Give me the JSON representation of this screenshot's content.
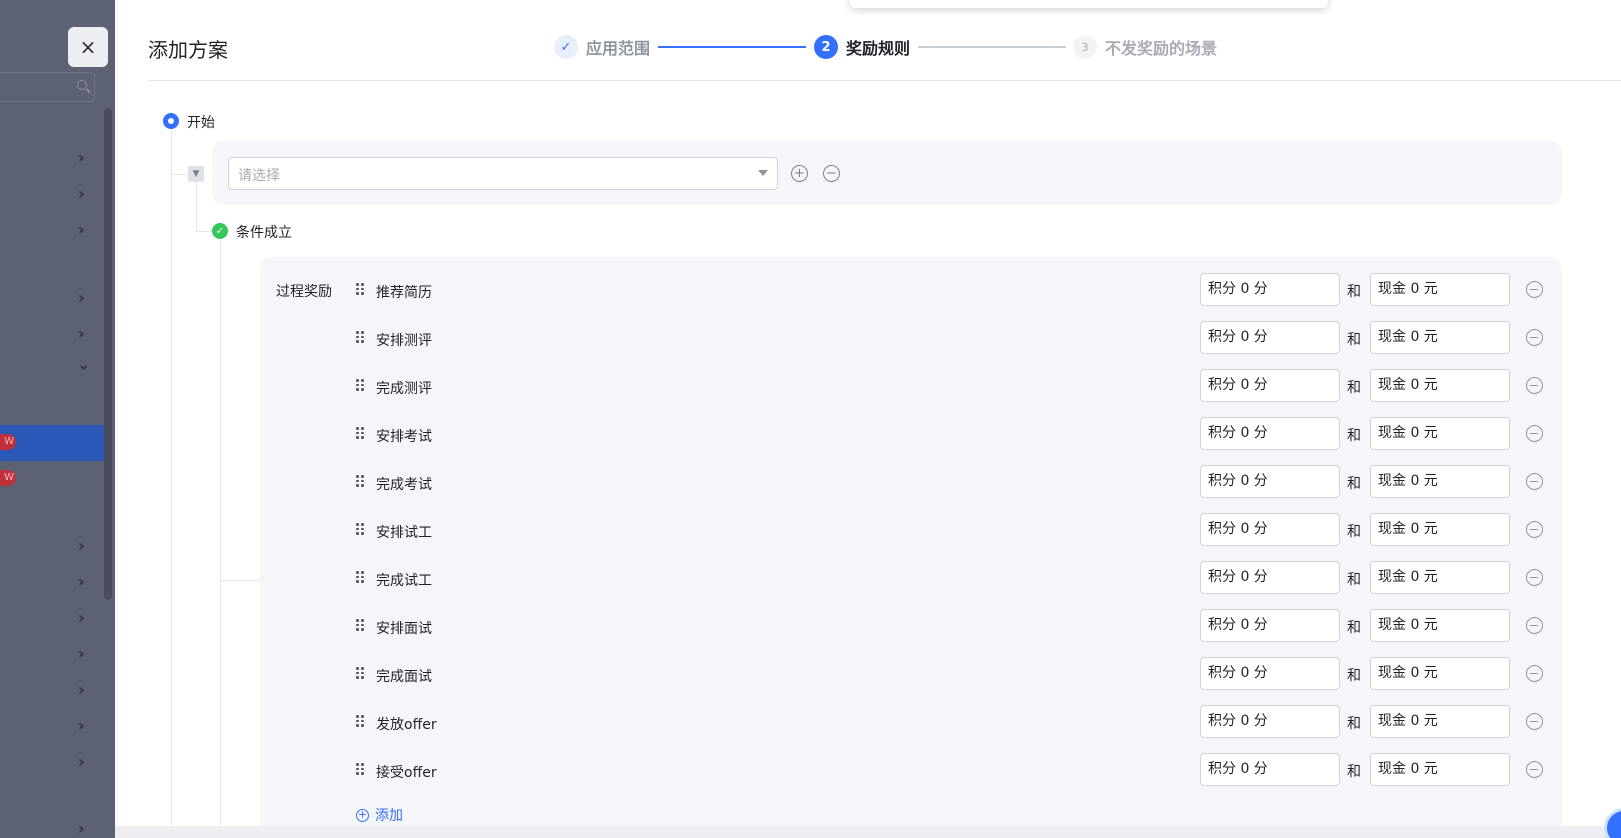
{
  "drawer": {
    "title": "添加方案",
    "close_label": "×"
  },
  "steps": [
    {
      "index": "✓",
      "label": "应用范围",
      "state": "done"
    },
    {
      "index": "2",
      "label": "奖励规则",
      "state": "active"
    },
    {
      "index": "3",
      "label": "不发奖励的场景",
      "state": "pending"
    }
  ],
  "tree": {
    "start_label": "开始",
    "select_placeholder": "请选择",
    "condition_met_label": "条件成立"
  },
  "reward": {
    "title": "过程奖励",
    "and_label": "和",
    "rows": [
      {
        "name": "推荐简历",
        "points": "积分 0 分",
        "cash": "现金 0 元"
      },
      {
        "name": "安排测评",
        "points": "积分 0 分",
        "cash": "现金 0 元"
      },
      {
        "name": "完成测评",
        "points": "积分 0 分",
        "cash": "现金 0 元"
      },
      {
        "name": "安排考试",
        "points": "积分 0 分",
        "cash": "现金 0 元"
      },
      {
        "name": "完成考试",
        "points": "积分 0 分",
        "cash": "现金 0 元"
      },
      {
        "name": "安排试工",
        "points": "积分 0 分",
        "cash": "现金 0 元"
      },
      {
        "name": "完成试工",
        "points": "积分 0 分",
        "cash": "现金 0 元"
      },
      {
        "name": "安排面试",
        "points": "积分 0 分",
        "cash": "现金 0 元"
      },
      {
        "name": "完成面试",
        "points": "积分 0 分",
        "cash": "现金 0 元"
      },
      {
        "name": "发放offer",
        "points": "积分 0 分",
        "cash": "现金 0 元"
      },
      {
        "name": "接受offer",
        "points": "积分 0 分",
        "cash": "现金 0 元"
      }
    ],
    "add_label": "添加"
  },
  "sidebar": {
    "badges": [
      "W",
      "W"
    ]
  },
  "colors": {
    "accent": "#3370ff",
    "success": "#34c759",
    "overlay": "#5d6174"
  }
}
